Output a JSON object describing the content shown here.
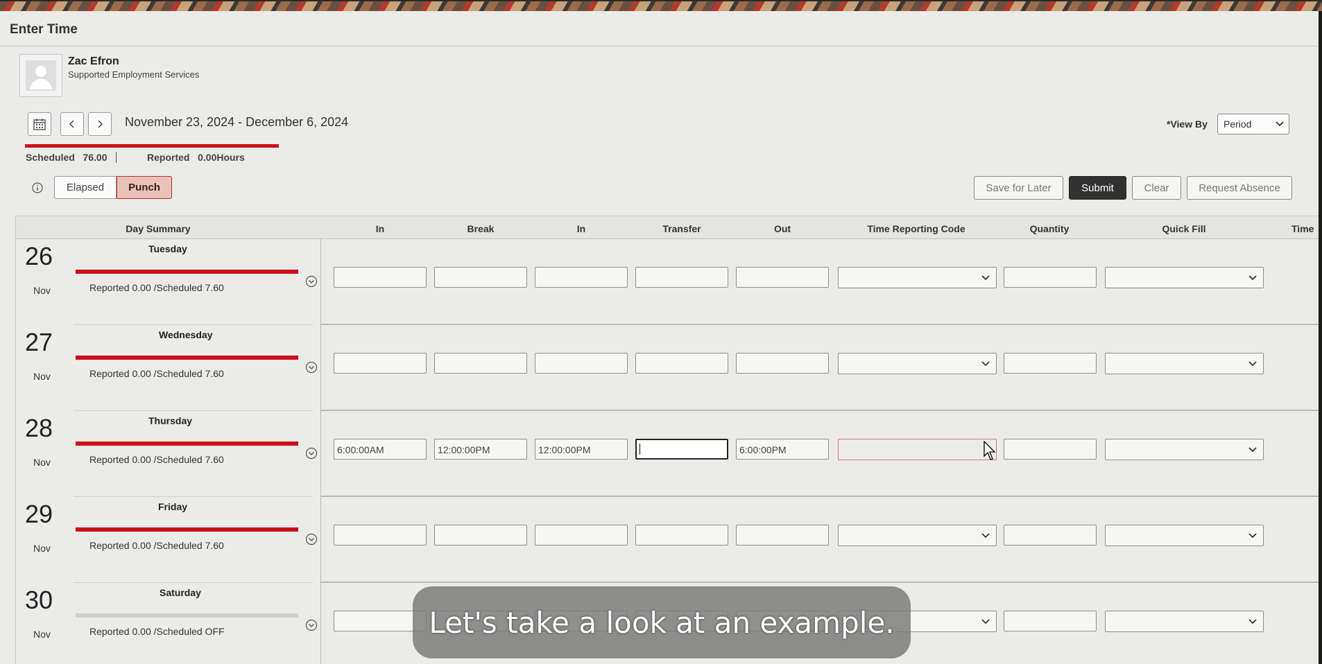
{
  "page": {
    "title": "Enter Time"
  },
  "employee": {
    "name": "Zac Efron",
    "department": "Supported Employment Services"
  },
  "period": {
    "range": "November 23, 2024 - December 6, 2024"
  },
  "summary": {
    "scheduled_label": "Scheduled",
    "scheduled_value": "76.00",
    "reported_label": "Reported",
    "reported_value": "0.00Hours"
  },
  "view_by": {
    "label": "*View By",
    "value": "Period"
  },
  "mode_toggle": {
    "elapsed": "Elapsed",
    "punch": "Punch",
    "selected": "Punch"
  },
  "actions": {
    "save_for_later": "Save for Later",
    "submit": "Submit",
    "clear": "Clear",
    "request_absence": "Request Absence"
  },
  "columns": [
    "Day Summary",
    "In",
    "Break",
    "In",
    "Transfer",
    "Out",
    "Time Reporting Code",
    "Quantity",
    "Quick Fill",
    "Time"
  ],
  "rows": [
    {
      "day": "26",
      "month": "Nov",
      "weekday": "Tuesday",
      "status": "Reported 0.00 /Scheduled 7.60",
      "bar": "scheduled",
      "in1": "",
      "break": "",
      "in2": "",
      "transfer": "",
      "out": ""
    },
    {
      "day": "27",
      "month": "Nov",
      "weekday": "Wednesday",
      "status": "Reported 0.00 /Scheduled 7.60",
      "bar": "scheduled",
      "in1": "",
      "break": "",
      "in2": "",
      "transfer": "",
      "out": ""
    },
    {
      "day": "28",
      "month": "Nov",
      "weekday": "Thursday",
      "status": "Reported 0.00 /Scheduled 7.60",
      "bar": "scheduled",
      "in1": "6:00:00AM",
      "break": "12:00:00PM",
      "in2": "12:00:00PM",
      "transfer": "",
      "out": "6:00:00PM"
    },
    {
      "day": "29",
      "month": "Nov",
      "weekday": "Friday",
      "status": "Reported 0.00 /Scheduled 7.60",
      "bar": "scheduled",
      "in1": "",
      "break": "",
      "in2": "",
      "transfer": "",
      "out": ""
    },
    {
      "day": "30",
      "month": "Nov",
      "weekday": "Saturday",
      "status": "Reported 0.00 /Scheduled OFF",
      "bar": "off",
      "in1": "",
      "break": "",
      "in2": "",
      "transfer": "",
      "out": ""
    }
  ],
  "caption": "Let's take a look at an example.",
  "colors": {
    "accent_red": "#cc0f19",
    "submit_bg": "#313131",
    "punch_bg": "#e8c3b7"
  }
}
